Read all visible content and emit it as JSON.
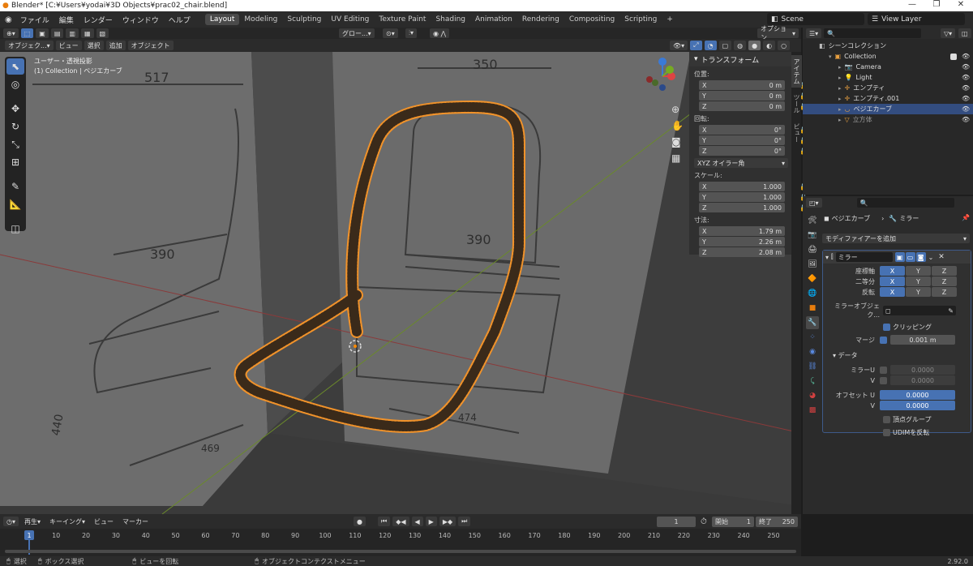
{
  "window": {
    "title": "Blender* [C:¥Users¥yodai¥3D Objects¥prac02_chair.blend]"
  },
  "menus": [
    "ファイル",
    "編集",
    "レンダー",
    "ウィンドウ",
    "ヘルプ"
  ],
  "workspaces": [
    "Layout",
    "Modeling",
    "Sculpting",
    "UV Editing",
    "Texture Paint",
    "Shading",
    "Animation",
    "Rendering",
    "Compositing",
    "Scripting"
  ],
  "active_workspace": "Layout",
  "scene": {
    "name": "Scene",
    "view_layer": "View Layer"
  },
  "viewport": {
    "mode": "オブジェク...",
    "menu": [
      "ビュー",
      "選択",
      "追加",
      "オブジェクト"
    ],
    "transform_orientation": "グロー...",
    "options": "オプション",
    "view_name": "ユーザー・透視投影",
    "collection_info": "(1) Collection | ベジエカーブ",
    "dims_on_sketch": [
      "517",
      "350",
      "390",
      "390",
      "474",
      "469",
      "440"
    ]
  },
  "npanel": {
    "title": "トランスフォーム",
    "location_label": "位置:",
    "location": [
      {
        "axis": "X",
        "value": "0 m"
      },
      {
        "axis": "Y",
        "value": "0 m"
      },
      {
        "axis": "Z",
        "value": "0 m"
      }
    ],
    "rotation_label": "回転:",
    "rotation": [
      {
        "axis": "X",
        "value": "0°"
      },
      {
        "axis": "Y",
        "value": "0°"
      },
      {
        "axis": "Z",
        "value": "0°"
      }
    ],
    "rotation_mode": "XYZ オイラー角",
    "scale_label": "スケール:",
    "scale": [
      {
        "axis": "X",
        "value": "1.000"
      },
      {
        "axis": "Y",
        "value": "1.000"
      },
      {
        "axis": "Z",
        "value": "1.000"
      }
    ],
    "dimensions_label": "寸法:",
    "dimensions": [
      {
        "axis": "X",
        "value": "1.79 m"
      },
      {
        "axis": "Y",
        "value": "2.26 m"
      },
      {
        "axis": "Z",
        "value": "2.08 m"
      }
    ],
    "tabs": [
      "アイテム",
      "ツール",
      "ビュー"
    ]
  },
  "outliner": {
    "scene_collection": "シーンコレクション",
    "items": [
      {
        "name": "Collection",
        "depth": 1,
        "selected": false
      },
      {
        "name": "Camera",
        "depth": 2,
        "selected": false
      },
      {
        "name": "Light",
        "depth": 2,
        "selected": false
      },
      {
        "name": "エンプティ",
        "depth": 2,
        "selected": false
      },
      {
        "name": "エンプティ.001",
        "depth": 2,
        "selected": false
      },
      {
        "name": "ベジエカーブ",
        "depth": 2,
        "selected": true
      },
      {
        "name": "立方体",
        "depth": 2,
        "selected": false
      }
    ]
  },
  "properties": {
    "object_name": "ベジエカーブ",
    "modifier_name_header": "ミラー",
    "add_modifier": "モディファイアーを追加",
    "modifier": {
      "name": "ミラー",
      "axis_label": "座標軸",
      "bisect_label": "二等分",
      "flip_label": "反転",
      "axes": [
        "X",
        "Y",
        "Z"
      ],
      "mirror_object_label": "ミラーオブジェク...",
      "clipping": "クリッピング",
      "merge_label": "マージ",
      "merge_value": "0.001 m",
      "data_label": "データ",
      "mirror_u_label": "ミラーU",
      "mirror_u_value": "0.0000",
      "v_label": "V",
      "mirror_v_value": "0.0000",
      "offset_u_label": "オフセット U",
      "offset_u_value": "0.0000",
      "offset_v_value": "0.0000",
      "vertex_group": "頂点グループ",
      "flip_udim": "UDIMを反転"
    }
  },
  "timeline": {
    "menu": [
      "再生",
      "キーイング",
      "ビュー",
      "マーカー"
    ],
    "current_frame": "1",
    "start_label": "開始",
    "start": "1",
    "end_label": "終了",
    "end": "250",
    "ticks": [
      "1",
      "10",
      "20",
      "30",
      "40",
      "50",
      "60",
      "70",
      "80",
      "90",
      "100",
      "110",
      "120",
      "130",
      "140",
      "150",
      "160",
      "170",
      "180",
      "190",
      "200",
      "210",
      "220",
      "230",
      "240",
      "250"
    ]
  },
  "statusbar": {
    "select": "選択",
    "box_select": "ボックス選択",
    "rotate_view": "ビューを回転",
    "context_menu": "オブジェクトコンテクストメニュー",
    "version": "2.92.0"
  }
}
